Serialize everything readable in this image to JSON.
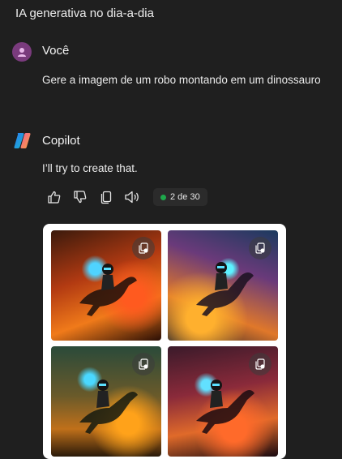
{
  "conversation": {
    "title": "IA generativa no dia-a-dia"
  },
  "user": {
    "name": "Você",
    "message": "Gere a imagem de um robo montando em um dinossauro"
  },
  "assistant": {
    "name": "Copilot",
    "message": "I’ll try to create that.",
    "counter": "2 de 30",
    "counter_status_color": "#1ea84b"
  },
  "actions": {
    "icons": [
      "thumbs-up-icon",
      "thumbs-down-icon",
      "copy-icon",
      "speaker-icon"
    ]
  },
  "images": {
    "count": 4,
    "overlay_icon": "copy-image-icon"
  },
  "colors": {
    "background": "#1f1f1f",
    "user_avatar": "#7a3b7d",
    "card": "#ffffff"
  }
}
